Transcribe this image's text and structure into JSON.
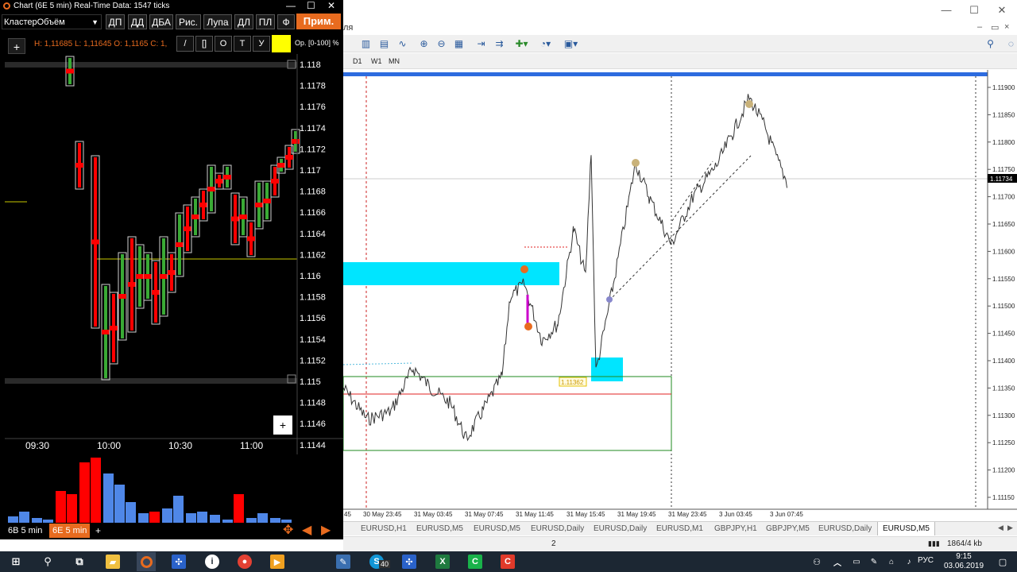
{
  "mt4": {
    "tf_buttons": [
      "D1",
      "W1",
      "MN"
    ],
    "price_labels": [
      "1.11900",
      "1.11850",
      "1.11800",
      "1.11750",
      "1.11700",
      "1.11650",
      "1.11600",
      "1.11550",
      "1.11500",
      "1.11450",
      "1.11400",
      "1.11350",
      "1.11300",
      "1.11250",
      "1.11200",
      "1.11150"
    ],
    "current_price": "1.11734",
    "level_tag": "1.11362",
    "time_labels": [
      "45",
      "30 May 23:45",
      "31 May 03:45",
      "31 May 07:45",
      "31 May 11:45",
      "31 May 15:45",
      "31 May 19:45",
      "31 May 23:45",
      "3 Jun 03:45",
      "3 Jun 07:45"
    ],
    "tabs": [
      {
        "label": "EURUSD,H1",
        "active": false
      },
      {
        "label": "EURUSD,M5",
        "active": false
      },
      {
        "label": "EURUSD,M5",
        "active": false
      },
      {
        "label": "EURUSD,Daily",
        "active": false
      },
      {
        "label": "EURUSD,Daily",
        "active": false
      },
      {
        "label": "EURUSD,M1",
        "active": false
      },
      {
        "label": "GBPJPY,H1",
        "active": false
      },
      {
        "label": "GBPJPY,M5",
        "active": false
      },
      {
        "label": "EURUSD,Daily",
        "active": false
      },
      {
        "label": "EURUSD,M5",
        "active": true
      }
    ],
    "status": {
      "page": "2",
      "traffic": "1864/4 kb"
    },
    "menu_fragment": "ля"
  },
  "cluster": {
    "title": "Chart (6E 5 min) Real-Time Data: 1547 ticks",
    "select_value": "КластерОбъём",
    "buttons": [
      "ДП",
      "ДД",
      "ДБА",
      "Рис.",
      "Лупа",
      "ДЛ",
      "ПЛ",
      "Ф"
    ],
    "apply_label": "Прим.",
    "ohlc_text": "H: 1,11685 L: 1,11645 O: 1,1165 C: 1,",
    "tools": [
      "/",
      "[]",
      "O",
      "T",
      "У"
    ],
    "op_label": "Ор. [0-100] %",
    "price_labels": [
      "1.118",
      "1.1178",
      "1.1176",
      "1.1174",
      "1.1172",
      "1.117",
      "1.1168",
      "1.1166",
      "1.1164",
      "1.1162",
      "1.116",
      "1.1158",
      "1.1156",
      "1.1154",
      "1.1152",
      "1.115",
      "1.1148",
      "1.1146",
      "1.1144"
    ],
    "time_labels": [
      "09:30",
      "10:00",
      "10:30",
      "11:00"
    ],
    "tabs": [
      {
        "label": "6B 5 min",
        "active": false
      },
      {
        "label": "6E 5 min",
        "active": true
      }
    ],
    "tab_plus": "+",
    "plus_label": "+"
  },
  "taskbar": {
    "skype_badge": "40",
    "lang": "РУС",
    "time": "9:15",
    "date": "03.06.2019"
  },
  "colors": {
    "accent_orange": "#e86b1f",
    "bull": "#3aaa35",
    "bear": "#ff0000",
    "zone_cyan": "#00e5ff",
    "volume_red": "#ff0000",
    "volume_blue": "#4f87e8"
  }
}
